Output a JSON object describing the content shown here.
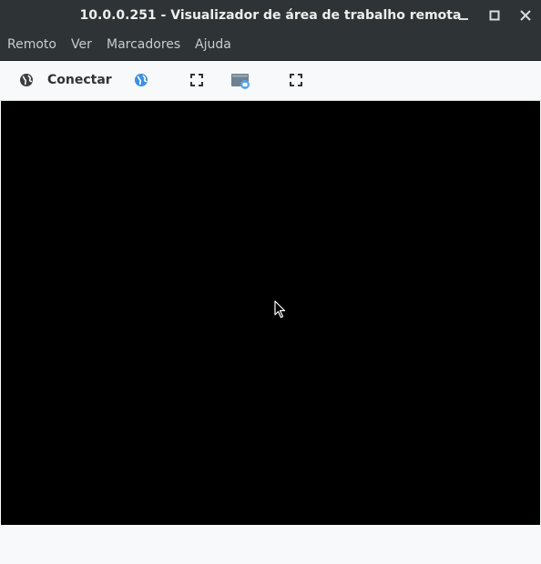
{
  "window": {
    "title": "10.0.0.251 - Visualizador de área de trabalho remota",
    "controls": [
      "minimize-icon",
      "maximize-icon",
      "close-icon"
    ]
  },
  "menu": {
    "items": [
      {
        "label": "Remoto"
      },
      {
        "label": "Ver"
      },
      {
        "label": "Marcadores"
      },
      {
        "label": "Ajuda"
      }
    ]
  },
  "toolbar": {
    "connect_label": "Conectar",
    "icons": [
      "globe-icon",
      "globe-blue-icon",
      "fullscreen-icon",
      "screenshot-icon",
      "fit-window-icon"
    ]
  },
  "colors": {
    "titlebar": "#2e3436",
    "toolbar": "#f8f9fa",
    "remote_screen": "#000000",
    "accent": "#3d8fe0"
  }
}
